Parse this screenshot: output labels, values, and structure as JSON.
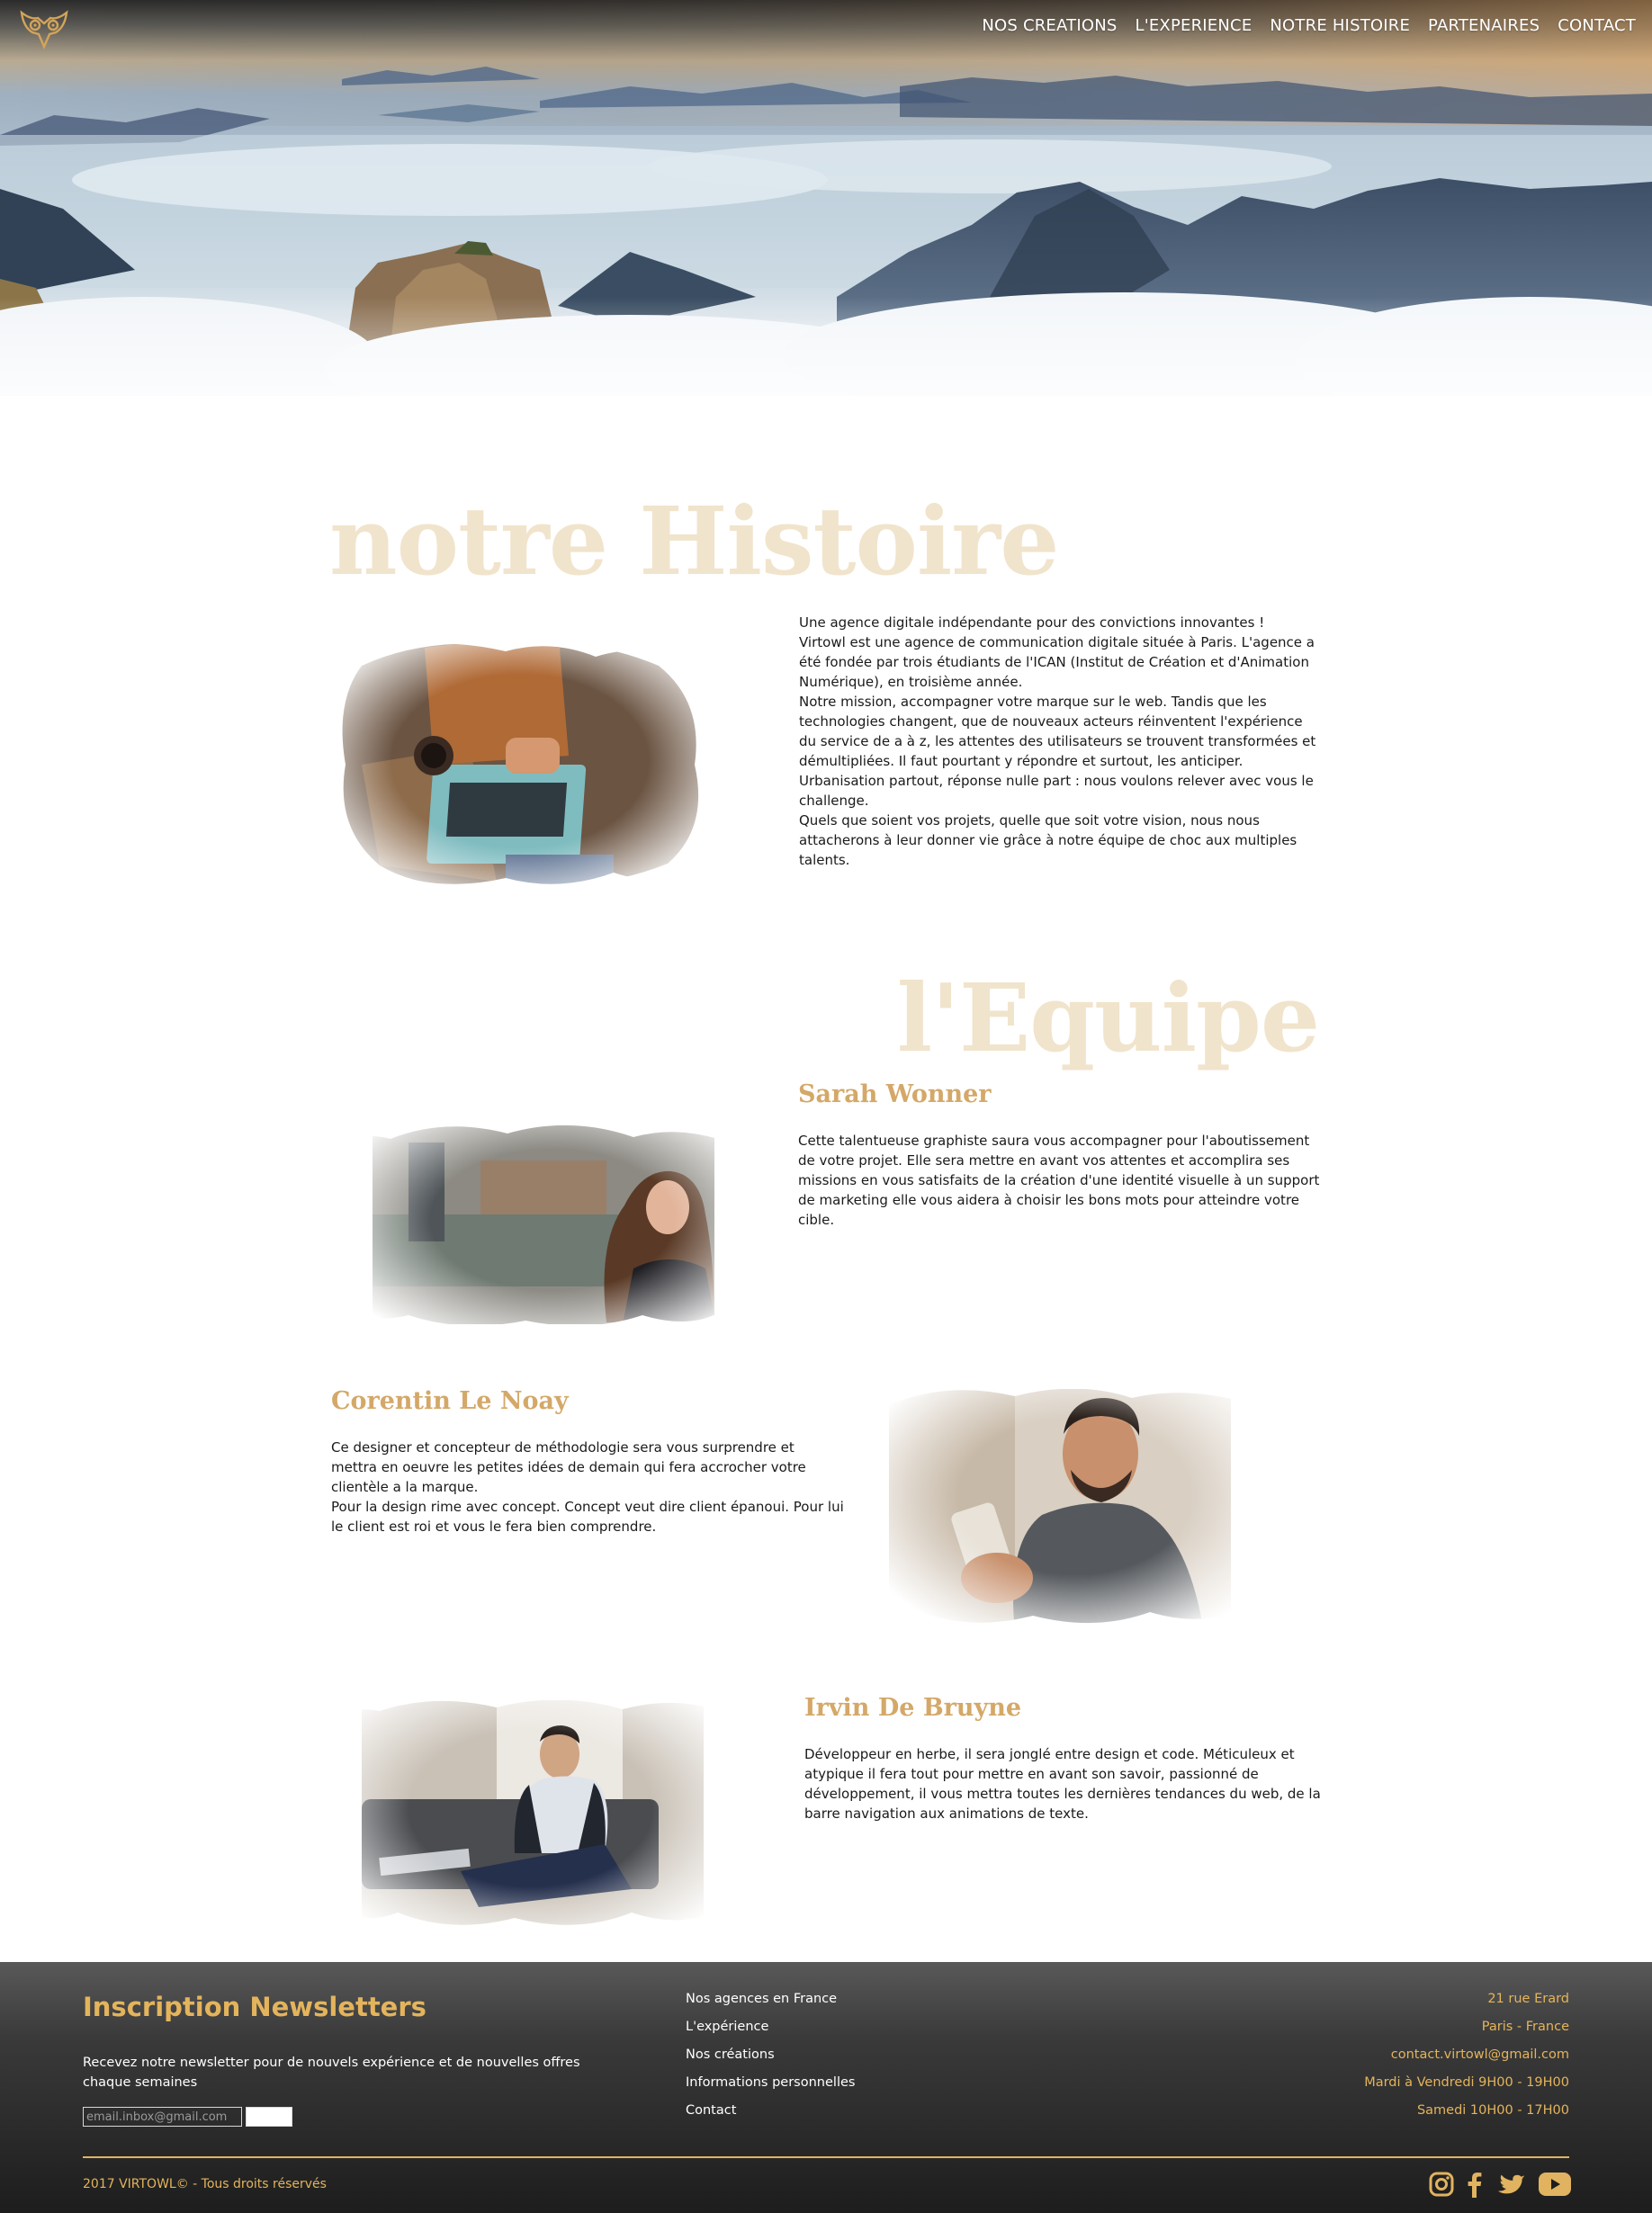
{
  "nav": {
    "logo_icon": "owl-logo-icon",
    "items": [
      {
        "label": "NOS CREATIONS"
      },
      {
        "label": "L'EXPERIENCE"
      },
      {
        "label": "NOTRE HISTOIRE"
      },
      {
        "label": "PARTENAIRES"
      },
      {
        "label": "CONTACT"
      }
    ]
  },
  "histoire": {
    "title": "notre Histoire",
    "lines": [
      "Une agence digitale indépendante pour des convictions innovantes !",
      "Virtowl est une agence de communication digitale située à Paris. L'agence a été fondée par trois étudiants de l'ICAN (Institut de Création et d'Animation Numérique), en troisième année.",
      "Notre mission, accompagner votre marque sur le web. Tandis que les technologies changent, que de nouveaux acteurs réinventent l'expérience du service de a à z, les attentes des utilisateurs se trouvent transformées et démultipliées. Il faut pourtant y répondre et surtout, les anticiper. Urbanisation partout, réponse nulle part : nous voulons relever avec vous le challenge.",
      "Quels que soient vos projets, quelle que soit votre vision, nous nous attacherons à leur donner vie grâce à notre équipe de choc aux multiples talents."
    ]
  },
  "equipe": {
    "title": "l'Equipe",
    "members": [
      {
        "name": "Sarah Wonner",
        "bio": [
          "Cette talentueuse graphiste saura vous accompagner pour l'aboutissement de votre projet. Elle sera mettre en avant vos attentes et accomplira ses missions en vous satisfaits de la création d'une identité visuelle à un support de marketing elle vous aidera à choisir les bons mots pour atteindre votre cible."
        ]
      },
      {
        "name": "Corentin Le Noay",
        "bio": [
          "Ce designer et concepteur de méthodologie sera vous surprendre et mettra en oeuvre les petites idées de demain qui fera accrocher votre clientèle a la marque.",
          "Pour la design rime avec concept. Concept veut dire client épanoui. Pour lui le client est roi et vous le fera bien comprendre."
        ]
      },
      {
        "name": "Irvin De Bruyne",
        "bio": [
          "Développeur en herbe, il sera jonglé entre design et code. Méticuleux et atypique il fera tout pour mettre en avant son savoir, passionné de développement, il vous mettra toutes les dernières tendances du web, de la barre navigation aux animations de texte."
        ]
      }
    ]
  },
  "footer": {
    "newsletter_title": "Inscription Newsletters",
    "newsletter_text": "Recevez notre newsletter pour de nouvels expérience et de nouvelles offres chaque semaines",
    "email_placeholder": "email.inbox@gmail.com",
    "links": [
      {
        "label": "Nos agences en France"
      },
      {
        "label": "L'expérience"
      },
      {
        "label": "Nos créations"
      },
      {
        "label": "Informations personnelles"
      },
      {
        "label": "Contact"
      }
    ],
    "contact": [
      "21 rue Erard",
      "Paris - France",
      "contact.virtowl@gmail.com",
      "Mardi à Vendredi 9H00 - 19H00",
      "Samedi 10H00 - 17H00"
    ],
    "copyright": "2017 VIRTOWL© - Tous droits réservés",
    "socials": [
      "instagram-icon",
      "facebook-icon",
      "twitter-icon",
      "youtube-icon"
    ]
  },
  "colors": {
    "accent": "#e4b45c",
    "title_beige": "#f1e4cc",
    "name_gold": "#d4a868"
  }
}
